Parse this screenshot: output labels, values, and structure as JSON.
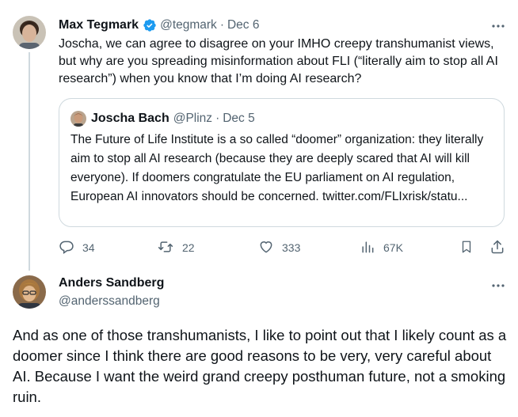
{
  "tweet1": {
    "author_name": "Max Tegmark",
    "handle": "@tegmark",
    "separator": "·",
    "date": "Dec 6",
    "body": "Joscha, we can agree to disagree on your IMHO creepy transhumanist views, but why are you spreading misinformation  about FLI (“literally aim to stop all AI research”) when you know that I’m doing AI research?",
    "more_label": "···",
    "quote": {
      "author_name": "Joscha Bach",
      "handle": "@Plinz",
      "separator": "·",
      "date": "Dec 5",
      "body": "The Future of Life Institute is a so called “doomer” organization: they literally aim to stop all AI research (because they are deeply scared that AI will kill everyone). If doomers congratulate the EU parliament on AI regulation, European AI innovators should be concerned. twitter.com/FLIxrisk/statu..."
    },
    "actions": {
      "replies": "34",
      "retweets": "22",
      "likes": "333",
      "views": "67K"
    }
  },
  "tweet2": {
    "author_name": "Anders Sandberg",
    "handle": "@anderssandberg",
    "more_label": "···",
    "body": "And as one of those transhumanists, I like to point out that I likely count as a doomer since I think there are good reasons to be very, very careful about AI. Because I want the weird grand creepy posthuman future, not a smoking ruin."
  },
  "colors": {
    "text": "#0f1419",
    "muted": "#536471",
    "verified": "#1d9bf0",
    "border": "#cfd9de"
  },
  "icons": [
    "verified-badge-icon",
    "more-icon",
    "reply-icon",
    "retweet-icon",
    "like-icon",
    "views-icon",
    "bookmark-icon",
    "share-icon"
  ]
}
